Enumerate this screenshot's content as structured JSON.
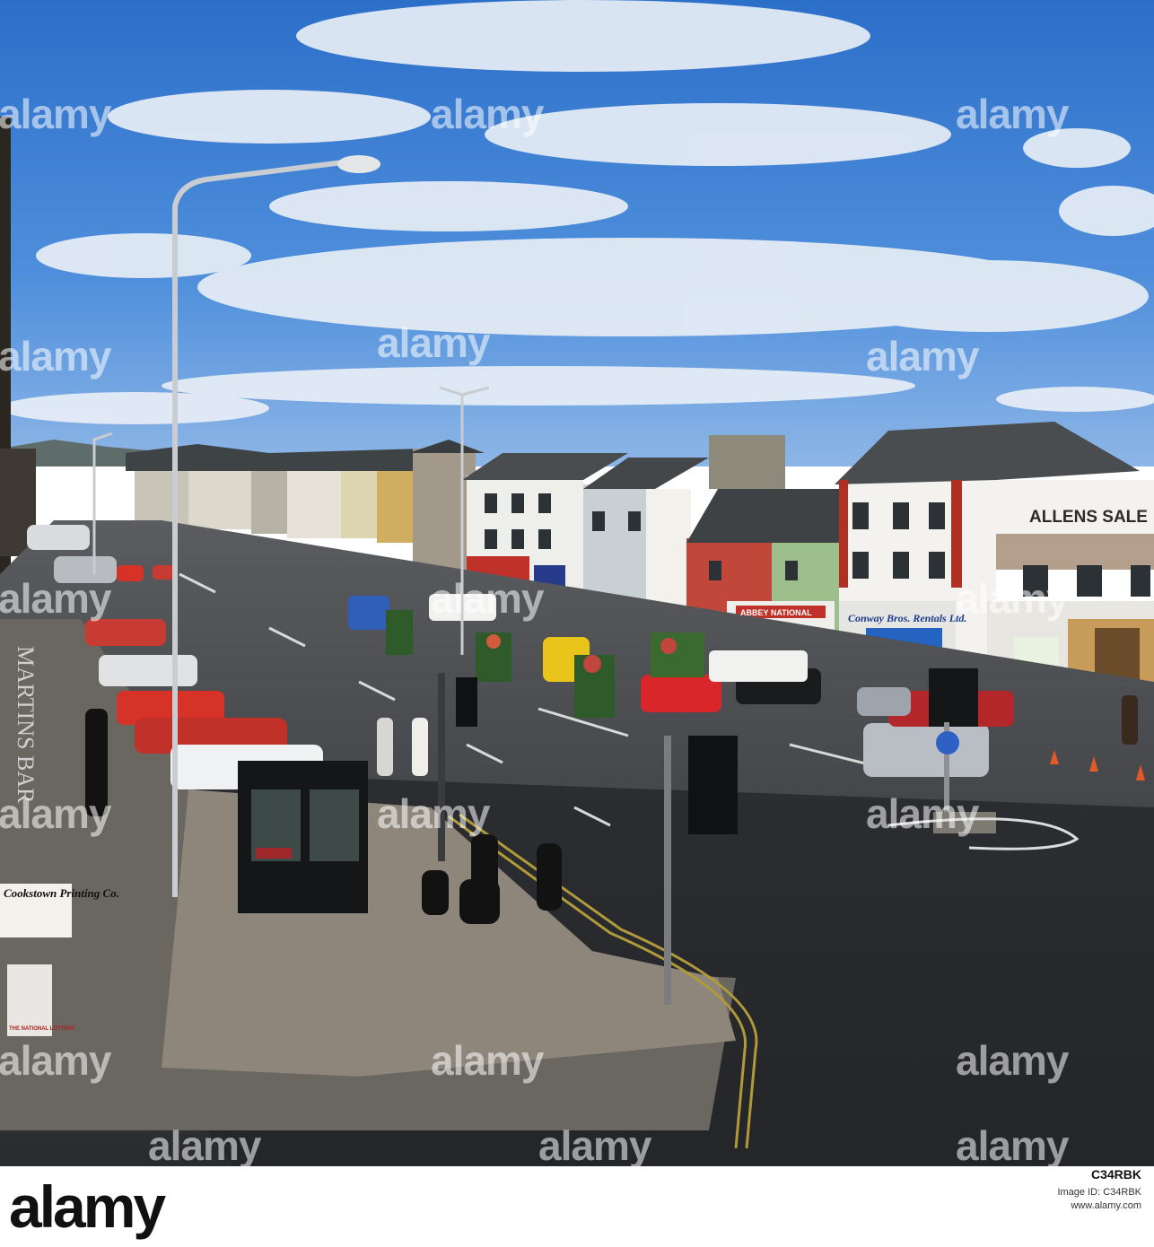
{
  "photo": {
    "watermark": "alamy",
    "signs": {
      "allens": "ALLENS SALE",
      "abbey": "ABBEY NATIONAL",
      "conway": "Conway Bros. Rentals Ltd.",
      "printing": "Cookstown Printing Co.",
      "lottery": "THE NATIONAL LOTTERY",
      "martins": "MARTINS BAR"
    }
  },
  "footer": {
    "logo": "alamy",
    "image_id": "C34RBK",
    "line1": "Image ID: C34RBK",
    "line2": "www.alamy.com"
  }
}
